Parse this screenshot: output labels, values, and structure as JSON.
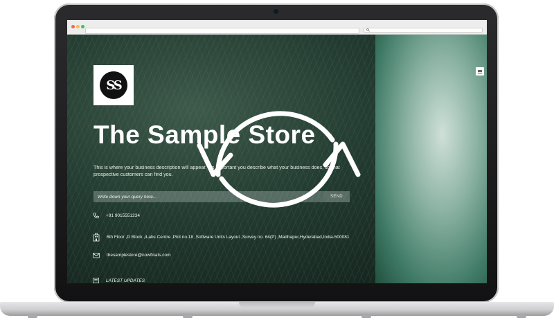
{
  "browser": {
    "traffic_lights": [
      "#fc615d",
      "#fdbc40",
      "#34c84a"
    ]
  },
  "store": {
    "logo_text": "SS",
    "title": "The Sample Store",
    "description": "This is where your business description will appear. It's important you describe what your business does, so that prospective customers can find you.",
    "search": {
      "placeholder": "Write down your query here...",
      "send_label": "SEND"
    },
    "contact": {
      "phone": "+91 9015551234",
      "address": "6th Floor ,D Block ,iLabs Centre ,Plot no.18 ,Software Units Layout ,Survey no. 64(P) ,Madhapur,Hyderabad,India-500081",
      "email": "thesamplestore@nowfloats.com"
    },
    "latest_updates_label": "LATEST UPDATES"
  },
  "overlay": {
    "icon": "sync-icon"
  },
  "colors": {
    "accent_green": "#3f7a66",
    "text": "#ffffff"
  }
}
